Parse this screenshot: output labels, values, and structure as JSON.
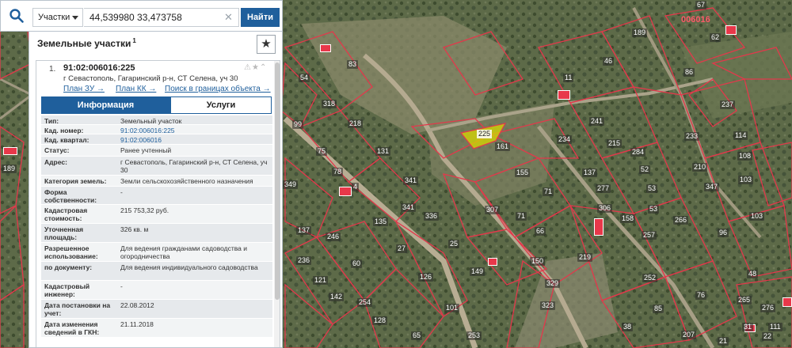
{
  "search": {
    "type_label": "Участки",
    "query": "44,539980 33,473758",
    "find_label": "Найти"
  },
  "panel": {
    "title": "Земельные участки",
    "count": "1",
    "result": {
      "index": "1.",
      "cad_number": "91:02:006016:225",
      "address": "г Севастополь, Гагаринский р-н, СТ Селена, уч 30",
      "links": [
        "План ЗУ →",
        "План КК →",
        "Поиск в границах объекта →"
      ]
    },
    "tabs": [
      "Информация",
      "Услуги"
    ],
    "properties": [
      {
        "key": "Тип:",
        "value": "Земельный участок"
      },
      {
        "key": "Кад. номер:",
        "value": "91:02:006016:225"
      },
      {
        "key": "Кад. квартал:",
        "value": "91:02:006016"
      },
      {
        "key": "Статус:",
        "value": "Ранее учтенный"
      },
      {
        "key": "Адрес:",
        "value": "г Севастополь, Гагаринский р-н, СТ Селена, уч 30"
      },
      {
        "key": "Категория земель:",
        "value": "Земли сельскохозяйственного назначения"
      },
      {
        "key": "Форма собственности:",
        "value": "-"
      },
      {
        "key": "Кадастровая стоимость:",
        "value": "215 753,32 руб."
      },
      {
        "key": "Уточненная площадь:",
        "value": "326 кв. м"
      },
      {
        "key": "Разрешенное использование:",
        "value": "Для ведения гражданами садоводства и огородничества"
      },
      {
        "key": "по документу:",
        "value": "Для ведения индивидуального садоводства"
      },
      {
        "key": "Кадастровый инженер:",
        "value": "-"
      },
      {
        "key": "Дата постановки на учет:",
        "value": "22.08.2012"
      },
      {
        "key": "Дата изменения сведений в ГКН:",
        "value": "21.11.2018"
      }
    ]
  },
  "map": {
    "highlighted_plot": "225",
    "corner_label": "006016",
    "plot_numbers": [
      "83",
      "54",
      "318",
      "218",
      "99",
      "75",
      "78",
      "131",
      "4",
      "341",
      "349",
      "341",
      "336",
      "137",
      "246",
      "135",
      "25",
      "27",
      "236",
      "60",
      "121",
      "126",
      "149",
      "142",
      "254",
      "101",
      "128",
      "65",
      "253",
      "189",
      "189",
      "46",
      "67",
      "62",
      "11",
      "86",
      "237",
      "241",
      "234",
      "215",
      "284",
      "233",
      "114",
      "108",
      "161",
      "155",
      "137",
      "52",
      "210",
      "277",
      "53",
      "347",
      "103",
      "71",
      "306",
      "158",
      "71",
      "53",
      "103",
      "266",
      "307",
      "66",
      "257",
      "96",
      "150",
      "219",
      "329",
      "252",
      "48",
      "323",
      "85",
      "76",
      "265",
      "276",
      "38",
      "207",
      "21",
      "22",
      "111",
      "31"
    ]
  }
}
